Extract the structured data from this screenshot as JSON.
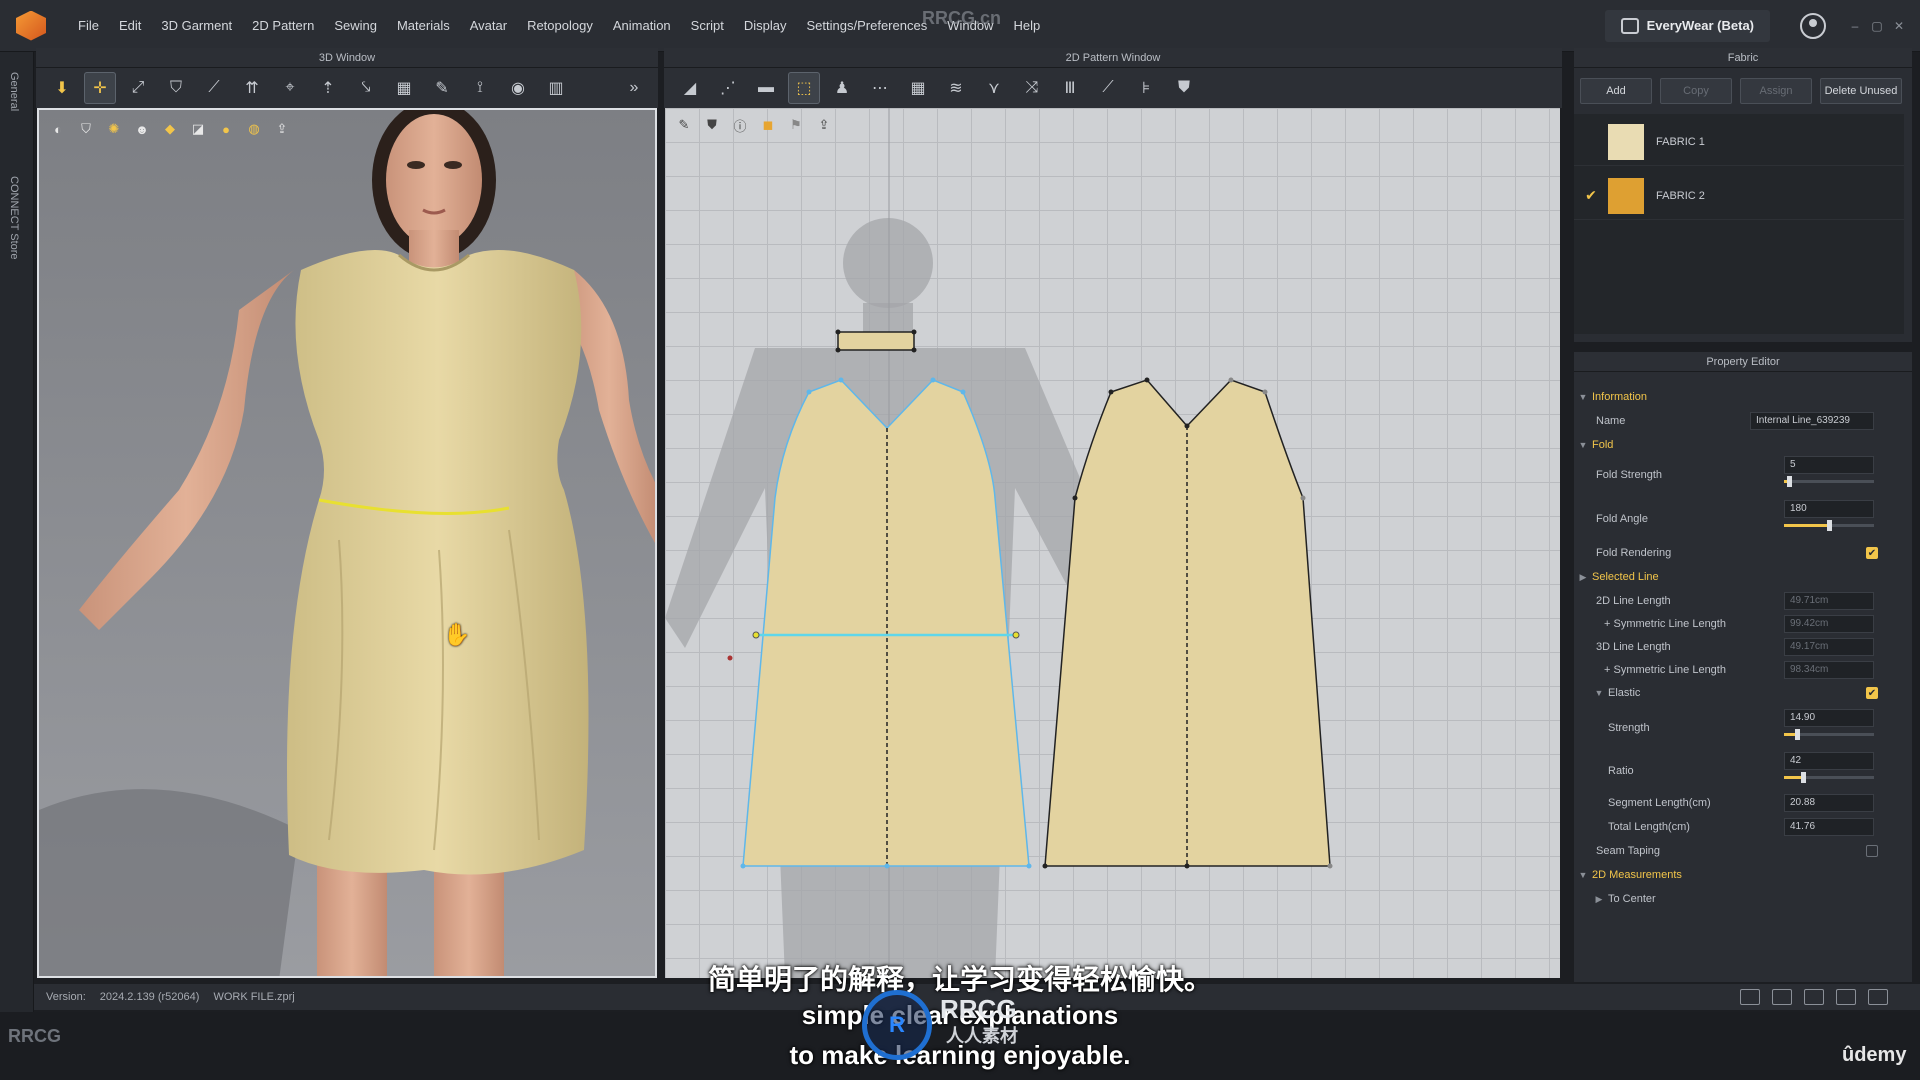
{
  "menu": {
    "items": [
      "File",
      "Edit",
      "3D Garment",
      "2D Pattern",
      "Sewing",
      "Materials",
      "Avatar",
      "Retopology",
      "Animation",
      "Script",
      "Display",
      "Settings/Preferences",
      "Window",
      "Help"
    ],
    "everywear_label": "EveryWear (Beta)"
  },
  "left_rail": {
    "general": "General",
    "connect": "CONNECT Store"
  },
  "panels": {
    "window3d_title": "3D Window",
    "window2d_title": "2D Pattern Window",
    "fabric_title": "Fabric",
    "property_title": "Property Editor"
  },
  "fabric": {
    "buttons": {
      "add": "Add",
      "copy": "Copy",
      "assign": "Assign",
      "delete_unused": "Delete Unused"
    },
    "items": [
      {
        "name": "FABRIC 1",
        "color": "#e9dcb3",
        "selected": false
      },
      {
        "name": "FABRIC 2",
        "color": "#dea032",
        "selected": true
      }
    ]
  },
  "property": {
    "information": "Information",
    "name_label": "Name",
    "name_value": "Internal Line_639239",
    "fold": "Fold",
    "fold_strength_label": "Fold Strength",
    "fold_strength_value": "5",
    "fold_strength_level": 0.05,
    "fold_angle_label": "Fold Angle",
    "fold_angle_value": "180",
    "fold_angle_level": 0.5,
    "fold_rendering_label": "Fold Rendering",
    "selected_line": "Selected Line",
    "line2d_label": "2D Line Length",
    "line2d_value": "49.71cm",
    "sym1_label": "+ Symmetric Line Length",
    "sym1_value": "99.42cm",
    "line3d_label": "3D Line Length",
    "line3d_value": "49.17cm",
    "sym2_label": "+ Symmetric Line Length",
    "sym2_value": "98.34cm",
    "elastic_label": "Elastic",
    "strength_label": "Strength",
    "strength_value": "14.90",
    "strength_level": 0.149,
    "ratio_label": "Ratio",
    "ratio_value": "42",
    "ratio_level": 0.21,
    "segment_label": "Segment Length(cm)",
    "segment_value": "20.88",
    "total_label": "Total Length(cm)",
    "total_value": "41.76",
    "seam_taping_label": "Seam Taping",
    "measurements": "2D Measurements",
    "to_center": "To Center"
  },
  "status": {
    "version_label": "Version:",
    "version_value": "2024.2.139 (r52064)",
    "file": "WORK FILE.zprj"
  },
  "subtitles": {
    "cn": "简单明了的解释，让学习变得轻松愉快。",
    "en1": "simple clear explanations",
    "en2": "to make learning enjoyable."
  },
  "watermarks": {
    "top": "RRCG.cn",
    "bottom_left": "RRCG",
    "center": "RRCG",
    "center_cn": "人人素材"
  },
  "brand": {
    "udemy": "ûdemy"
  },
  "colors": {
    "accent": "#f2c54a",
    "garment": "#e3d3a0",
    "skin": "#d9a98c"
  }
}
